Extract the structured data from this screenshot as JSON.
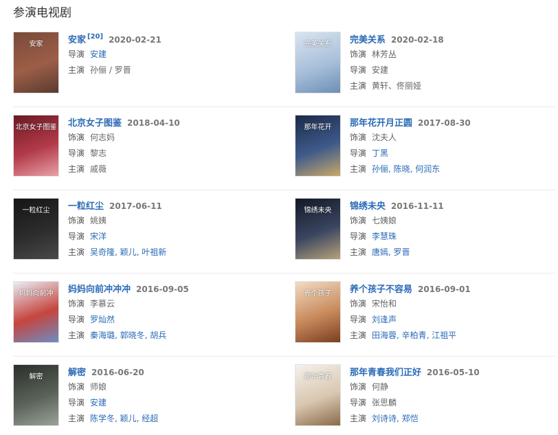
{
  "section_title": "参演电视剧",
  "items": [
    {
      "title": "安家",
      "sup": "[20]",
      "date": "2020-02-21",
      "rows": [
        {
          "label": "导演",
          "value": "安建",
          "linked": true
        },
        {
          "label": "主演",
          "value": "孙俪 / 罗晋",
          "linked": false
        }
      ],
      "poster": {
        "text": "安家",
        "colors": [
          "#7a4a3a",
          "#9c5e47",
          "#5a3b30"
        ]
      }
    },
    {
      "title": "完美关系",
      "sup": "",
      "date": "2020-02-18",
      "rows": [
        {
          "label": "饰演",
          "value": "林芳丛",
          "linked": false
        },
        {
          "label": "导演",
          "value": "安建",
          "linked": false
        },
        {
          "label": "主演",
          "value": "黄轩、佟丽娅",
          "linked": false
        }
      ],
      "poster": {
        "text": "完美关系",
        "colors": [
          "#d8e4f0",
          "#a9c0da",
          "#6d8fb5"
        ]
      }
    },
    {
      "title": "北京女子图鉴",
      "sup": "",
      "date": "2018-04-10",
      "rows": [
        {
          "label": "饰演",
          "value": "何志妈",
          "linked": false
        },
        {
          "label": "导演",
          "value": "黎志",
          "linked": false
        },
        {
          "label": "主演",
          "value": "戚薇",
          "linked": false
        }
      ],
      "poster": {
        "text": "北京女子图鉴",
        "colors": [
          "#6b1a22",
          "#b23a48",
          "#e8a0a8"
        ]
      }
    },
    {
      "title": "那年花开月正圆",
      "sup": "",
      "date": "2017-08-30",
      "rows": [
        {
          "label": "饰演",
          "value": "沈夫人",
          "linked": false
        },
        {
          "label": "导演",
          "value": "丁黑",
          "linked": true
        },
        {
          "label": "主演",
          "value": "孙俪, 陈晓, 何润东",
          "linked": true
        }
      ],
      "poster": {
        "text": "那年花开",
        "colors": [
          "#1c2a4a",
          "#3e5a8a",
          "#c9a86a"
        ]
      }
    },
    {
      "title": "一粒红尘",
      "sup": "",
      "date": "2017-06-11",
      "rows": [
        {
          "label": "饰演",
          "value": "姚姨",
          "linked": false
        },
        {
          "label": "导演",
          "value": "宋洋",
          "linked": true
        },
        {
          "label": "主演",
          "value": "吴奇隆, 颖儿, 叶祖新",
          "linked": true
        }
      ],
      "poster": {
        "text": "一粒红尘",
        "colors": [
          "#151515",
          "#2c2c2c",
          "#4a4a4a"
        ]
      }
    },
    {
      "title": "锦绣未央",
      "sup": "",
      "date": "2016-11-11",
      "rows": [
        {
          "label": "饰演",
          "value": "七姨娘",
          "linked": false
        },
        {
          "label": "导演",
          "value": "李慧珠",
          "linked": true
        },
        {
          "label": "主演",
          "value": "唐嫣, 罗晋",
          "linked": true
        }
      ],
      "poster": {
        "text": "锦绣未央",
        "colors": [
          "#121826",
          "#3a4560",
          "#b7a27a"
        ]
      }
    },
    {
      "title": "妈妈向前冲冲冲",
      "sup": "",
      "date": "2016-09-05",
      "rows": [
        {
          "label": "饰演",
          "value": "李慕云",
          "linked": false
        },
        {
          "label": "导演",
          "value": "罗灿然",
          "linked": true
        },
        {
          "label": "主演",
          "value": "秦海璐, 郭晓冬, 胡兵",
          "linked": true
        }
      ],
      "poster": {
        "text": "妈妈向前冲",
        "colors": [
          "#e9eef6",
          "#c6453e",
          "#6d8cc2"
        ]
      }
    },
    {
      "title": "养个孩子不容易",
      "sup": "",
      "date": "2016-09-01",
      "rows": [
        {
          "label": "饰演",
          "value": "宋怡和",
          "linked": false
        },
        {
          "label": "导演",
          "value": "刘逢声",
          "linked": true
        },
        {
          "label": "主演",
          "value": "田海蓉, 辛柏青, 江祖平",
          "linked": true
        }
      ],
      "poster": {
        "text": "养个孩子",
        "colors": [
          "#f2dcc4",
          "#c98a5c",
          "#7a3e22"
        ]
      }
    },
    {
      "title": "解密",
      "sup": "",
      "date": "2016-06-20",
      "rows": [
        {
          "label": "饰演",
          "value": "师娘",
          "linked": false
        },
        {
          "label": "导演",
          "value": "安建",
          "linked": true
        },
        {
          "label": "主演",
          "value": "陈学冬, 颖儿, 经超",
          "linked": true
        }
      ],
      "poster": {
        "text": "解密",
        "colors": [
          "#2a2f2a",
          "#5a6258",
          "#9aa39a"
        ]
      }
    },
    {
      "title": "那年青春我们正好",
      "sup": "",
      "date": "2016-05-10",
      "rows": [
        {
          "label": "饰演",
          "value": "何静",
          "linked": false
        },
        {
          "label": "导演",
          "value": "张思麟",
          "linked": false
        },
        {
          "label": "主演",
          "value": "刘诗诗, 郑恺",
          "linked": true
        }
      ],
      "poster": {
        "text": "那年青春",
        "colors": [
          "#f4f1ec",
          "#d9c7b0",
          "#8a6a4a"
        ]
      }
    }
  ]
}
